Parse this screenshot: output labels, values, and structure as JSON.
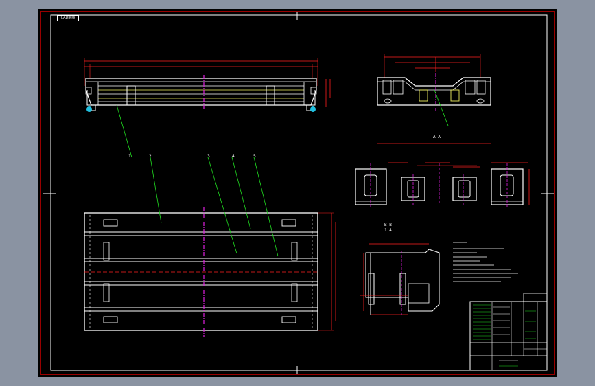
{
  "sheet": {
    "frame_color": "#ff0000",
    "background_color": "#000000",
    "outer_background": "#8a93a2"
  },
  "corner_tag": {
    "text": "CAD制图"
  },
  "section_labels": {
    "a_a": "A-A",
    "b_b": "B-B",
    "b_b_scale": "1:4"
  },
  "balloons": [
    "1",
    "2",
    "3",
    "4",
    "5"
  ],
  "colors": {
    "outline": "#ffffff",
    "dimension": "#ff2020",
    "centerline": "#e020e0",
    "leader": "#20e020",
    "highlight": "#f0f060",
    "accent": "#20c0e0"
  }
}
